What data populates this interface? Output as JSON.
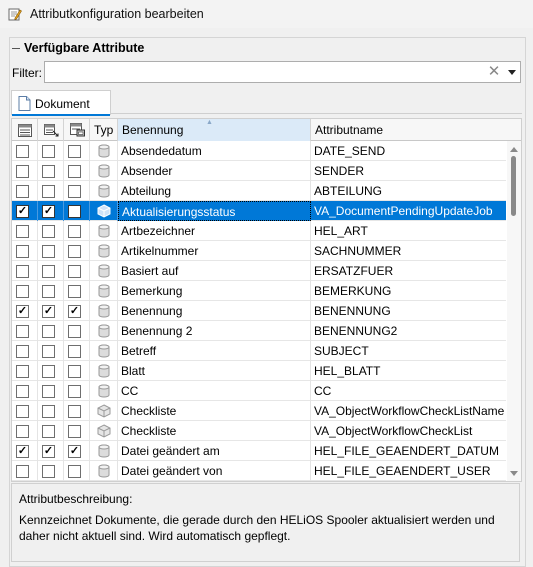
{
  "window": {
    "title": "Attributkonfiguration bearbeiten",
    "icon": "edit-window-icon"
  },
  "group": {
    "title": "Verfügbare Attribute"
  },
  "filter": {
    "label": "Filter:",
    "value": "",
    "placeholder": ""
  },
  "tabs": [
    {
      "label": "Dokument",
      "icon": "document-icon",
      "active": true
    }
  ],
  "grid": {
    "columns": [
      {
        "key": "col1",
        "icon": "list-view-icon",
        "label": ""
      },
      {
        "key": "col2",
        "icon": "sort-list-icon",
        "label": ""
      },
      {
        "key": "col3",
        "icon": "print-list-icon",
        "label": ""
      },
      {
        "key": "typ",
        "label": "Typ"
      },
      {
        "key": "name",
        "label": "Benennung",
        "sorted": "ascending"
      },
      {
        "key": "attr",
        "label": "Attributname"
      }
    ],
    "rows": [
      {
        "c1": false,
        "c2": false,
        "c3": false,
        "typ": "cylinder",
        "name": "Absendedatum",
        "attr": "DATE_SEND",
        "selected": false
      },
      {
        "c1": false,
        "c2": false,
        "c3": false,
        "typ": "cylinder",
        "name": "Absender",
        "attr": "SENDER",
        "selected": false
      },
      {
        "c1": false,
        "c2": false,
        "c3": false,
        "typ": "cylinder",
        "name": "Abteilung",
        "attr": "ABTEILUNG",
        "selected": false
      },
      {
        "c1": true,
        "c2": true,
        "c3": false,
        "typ": "cube",
        "name": "Aktualisierungsstatus",
        "attr": "VA_DocumentPendingUpdateJob",
        "selected": true
      },
      {
        "c1": false,
        "c2": false,
        "c3": false,
        "typ": "cylinder",
        "name": "Artbezeichner",
        "attr": "HEL_ART",
        "selected": false
      },
      {
        "c1": false,
        "c2": false,
        "c3": false,
        "typ": "cylinder",
        "name": "Artikelnummer",
        "attr": "SACHNUMMER",
        "selected": false
      },
      {
        "c1": false,
        "c2": false,
        "c3": false,
        "typ": "cylinder",
        "name": "Basiert auf",
        "attr": "ERSATZFUER",
        "selected": false
      },
      {
        "c1": false,
        "c2": false,
        "c3": false,
        "typ": "cylinder",
        "name": "Bemerkung",
        "attr": "BEMERKUNG",
        "selected": false
      },
      {
        "c1": true,
        "c2": true,
        "c3": true,
        "typ": "cylinder",
        "name": "Benennung",
        "attr": "BENENNUNG",
        "selected": false
      },
      {
        "c1": false,
        "c2": false,
        "c3": false,
        "typ": "cylinder",
        "name": "Benennung 2",
        "attr": "BENENNUNG2",
        "selected": false
      },
      {
        "c1": false,
        "c2": false,
        "c3": false,
        "typ": "cylinder",
        "name": "Betreff",
        "attr": "SUBJECT",
        "selected": false
      },
      {
        "c1": false,
        "c2": false,
        "c3": false,
        "typ": "cylinder",
        "name": "Blatt",
        "attr": "HEL_BLATT",
        "selected": false
      },
      {
        "c1": false,
        "c2": false,
        "c3": false,
        "typ": "cylinder",
        "name": "CC",
        "attr": "CC",
        "selected": false
      },
      {
        "c1": false,
        "c2": false,
        "c3": false,
        "typ": "cube",
        "name": "Checkliste",
        "attr": "VA_ObjectWorkflowCheckListName",
        "selected": false
      },
      {
        "c1": false,
        "c2": false,
        "c3": false,
        "typ": "cube",
        "name": "Checkliste",
        "attr": "VA_ObjectWorkflowCheckList",
        "selected": false
      },
      {
        "c1": true,
        "c2": true,
        "c3": true,
        "typ": "cylinder",
        "name": "Datei geändert am",
        "attr": "HEL_FILE_GEAENDERT_DATUM",
        "selected": false
      },
      {
        "c1": false,
        "c2": false,
        "c3": false,
        "typ": "cylinder",
        "name": "Datei geändert von",
        "attr": "HEL_FILE_GEAENDERT_USER",
        "selected": false
      }
    ]
  },
  "description": {
    "label": "Attributbeschreibung:",
    "text": "Kennzeichnet Dokumente, die gerade durch den HELiOS Spooler aktualisiert werden und daher nicht aktuell sind. Wird automatisch gepflegt."
  },
  "colors": {
    "selection": "#0078d7",
    "header_sorted": "#dbeaf8",
    "background": "#f0f0f0"
  }
}
